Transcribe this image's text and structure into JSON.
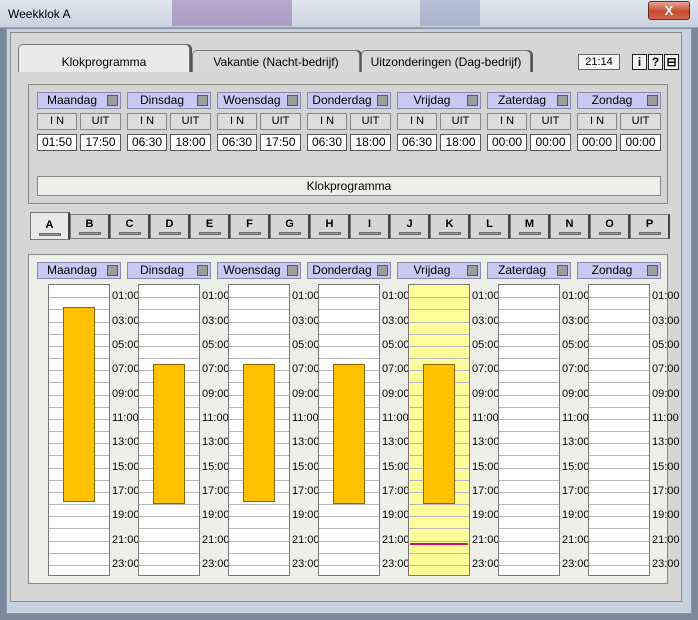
{
  "window": {
    "title": "Weekklok A",
    "close_label": "X"
  },
  "tabs": [
    {
      "label": "Klokprogramma",
      "active": true
    },
    {
      "label": "Vakantie  (Nacht-bedrijf)",
      "active": false
    },
    {
      "label": "Uitzonderingen (Dag-bedrijf)",
      "active": false
    }
  ],
  "clock": "21:14",
  "header_icons": [
    "info-icon",
    "help-icon",
    "window-icon"
  ],
  "header_icon_glyphs": [
    "i",
    "?",
    "⊟"
  ],
  "io_labels": {
    "in": "I N",
    "out": "UIT"
  },
  "days": [
    {
      "name": "Maandag",
      "in": "01:50",
      "out": "17:50"
    },
    {
      "name": "Dinsdag",
      "in": "06:30",
      "out": "18:00"
    },
    {
      "name": "Woensdag",
      "in": "06:30",
      "out": "17:50"
    },
    {
      "name": "Donderdag",
      "in": "06:30",
      "out": "18:00"
    },
    {
      "name": "Vrijdag",
      "in": "06:30",
      "out": "18:00"
    },
    {
      "name": "Zaterdag",
      "in": "00:00",
      "out": "00:00"
    },
    {
      "name": "Zondag",
      "in": "00:00",
      "out": "00:00"
    }
  ],
  "program_label": "Klokprogramma",
  "letter_tabs": [
    "A",
    "B",
    "C",
    "D",
    "E",
    "F",
    "G",
    "H",
    "I",
    "J",
    "K",
    "L",
    "M",
    "N",
    "O",
    "P"
  ],
  "active_letter": "A",
  "hour_labels": [
    "01:00",
    "03:00",
    "05:00",
    "07:00",
    "09:00",
    "11:00",
    "13:00",
    "15:00",
    "17:00",
    "19:00",
    "21:00",
    "23:00"
  ],
  "current_day": "Vrijdag",
  "current_time_marker": "21:14",
  "colors": {
    "day_header": "#c7c9f2",
    "on_bar": "#ffc000",
    "current_day_bg": "#ffff99",
    "time_marker": "#d0106a"
  }
}
